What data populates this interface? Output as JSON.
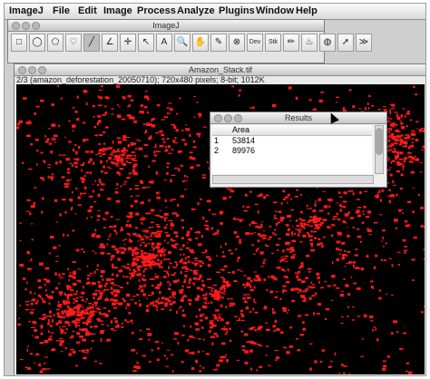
{
  "menubar": {
    "items": [
      "ImageJ",
      "File",
      "Edit",
      "Image",
      "Process",
      "Analyze",
      "Plugins",
      "Window",
      "Help"
    ]
  },
  "toolbar_window": {
    "title": "ImageJ",
    "tools": [
      {
        "name": "rectangle-tool-icon",
        "glyph": "□"
      },
      {
        "name": "oval-tool-icon",
        "glyph": "◯"
      },
      {
        "name": "polygon-tool-icon",
        "glyph": "⬠"
      },
      {
        "name": "freehand-tool-icon",
        "glyph": "♡"
      },
      {
        "name": "line-tool-icon",
        "glyph": "╱"
      },
      {
        "name": "angle-tool-icon",
        "glyph": "∠"
      },
      {
        "name": "point-tool-icon",
        "glyph": "✛"
      },
      {
        "name": "wand-tool-icon",
        "glyph": "↖"
      },
      {
        "name": "text-tool-icon",
        "glyph": "A"
      },
      {
        "name": "magnifier-tool-icon",
        "glyph": "🔍"
      },
      {
        "name": "hand-tool-icon",
        "glyph": "✋"
      },
      {
        "name": "color-picker-tool-icon",
        "glyph": "✎"
      },
      {
        "name": "stop-tool-icon",
        "glyph": "⊗"
      },
      {
        "name": "dev-tool-icon",
        "glyph": "Dev"
      },
      {
        "name": "stk-tool-icon",
        "glyph": "Stk"
      },
      {
        "name": "pencil-tool-icon",
        "glyph": "✏"
      },
      {
        "name": "brush-tool-icon",
        "glyph": "♨"
      },
      {
        "name": "flood-fill-tool-icon",
        "glyph": "◍"
      },
      {
        "name": "arrow-tool-icon",
        "glyph": "➚"
      },
      {
        "name": "more-tools-icon",
        "glyph": "≫"
      }
    ]
  },
  "image_window": {
    "title": "Amazon_Stack.tif",
    "info": "2/3 (amazon_deforestation_20050710); 720x480 pixels; 8-bit; 1012K"
  },
  "results_window": {
    "title": "Results",
    "column_header": "Area",
    "rows": [
      {
        "index": "1",
        "area": "53814"
      },
      {
        "index": "2",
        "area": "89976"
      }
    ]
  },
  "colors": {
    "deforestation_red": "#ff1a1a",
    "background_black": "#000000"
  }
}
